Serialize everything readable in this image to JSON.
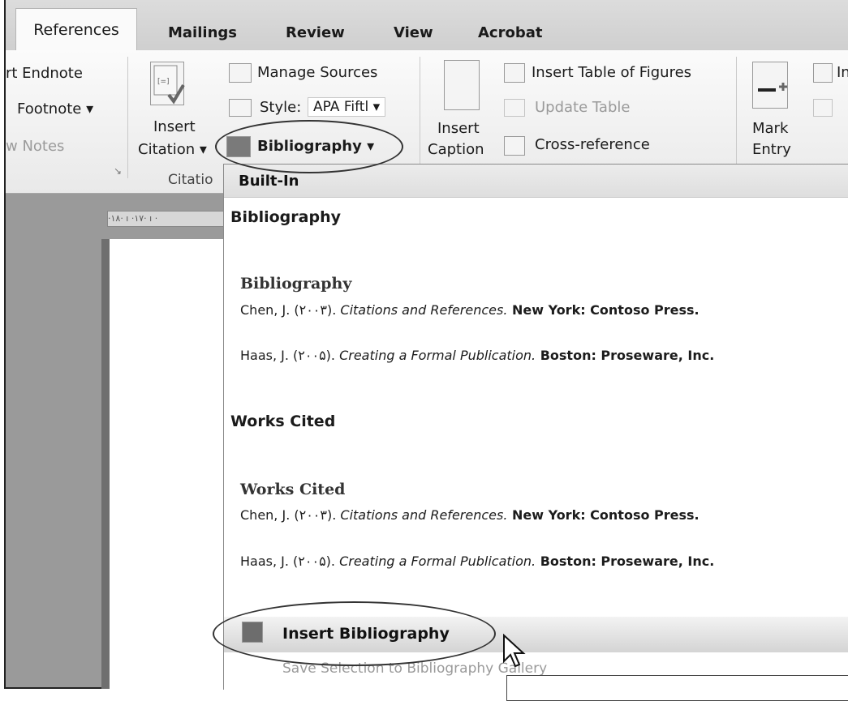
{
  "tabs": [
    {
      "label": "References"
    },
    {
      "label": "Mailings"
    },
    {
      "label": "Review"
    },
    {
      "label": "View"
    },
    {
      "label": "Acrobat"
    }
  ],
  "ribbon": {
    "footnotes": {
      "endnote": "rt Endnote",
      "footnote": "Footnote ▾",
      "notes": "w Notes"
    },
    "citations": {
      "insert_citation_l1": "Insert",
      "insert_citation_l2": "Citation ▾",
      "manage_sources": "Manage Sources",
      "style_label": "Style:",
      "style_value": "APA Fiftl ▾",
      "bibliography": "Bibliography ▾",
      "group_label": "Citatio"
    },
    "captions": {
      "insert_caption_l1": "Insert",
      "insert_caption_l2": "Caption",
      "table_of_figures": "Insert Table of Figures",
      "update_table": "Update Table",
      "cross_reference": "Cross-reference"
    },
    "index": {
      "mark_entry_l1": "Mark",
      "mark_entry_l2": "Entry",
      "insert_index": "In"
    }
  },
  "ruler_text": "·۱۸· ı ·۱۷· ı ·",
  "dropdown": {
    "header": "Built-In",
    "items": [
      {
        "name": "Bibliography",
        "preview_title": "Bibliography",
        "entries": [
          {
            "author": "Chen, J. (۲۰۰۳). ",
            "title": "Citations and References.",
            "rest": " New York: Contoso Press."
          },
          {
            "author": "Haas, J. (۲۰۰۵). ",
            "title": "Creating a Formal Publication.",
            "rest": " Boston: Proseware, Inc."
          }
        ]
      },
      {
        "name": "Works Cited",
        "preview_title": "Works Cited",
        "entries": [
          {
            "author": "Chen, J. (۲۰۰۳). ",
            "title": "Citations and References.",
            "rest": " New York: Contoso Press."
          },
          {
            "author": "Haas, J. (۲۰۰۵). ",
            "title": "Creating a Formal Publication.",
            "rest": " Boston: Proseware, Inc."
          }
        ]
      }
    ],
    "insert_command": "Insert Bibliography",
    "save_command": "Save Selection to Bibliography Gallery"
  }
}
